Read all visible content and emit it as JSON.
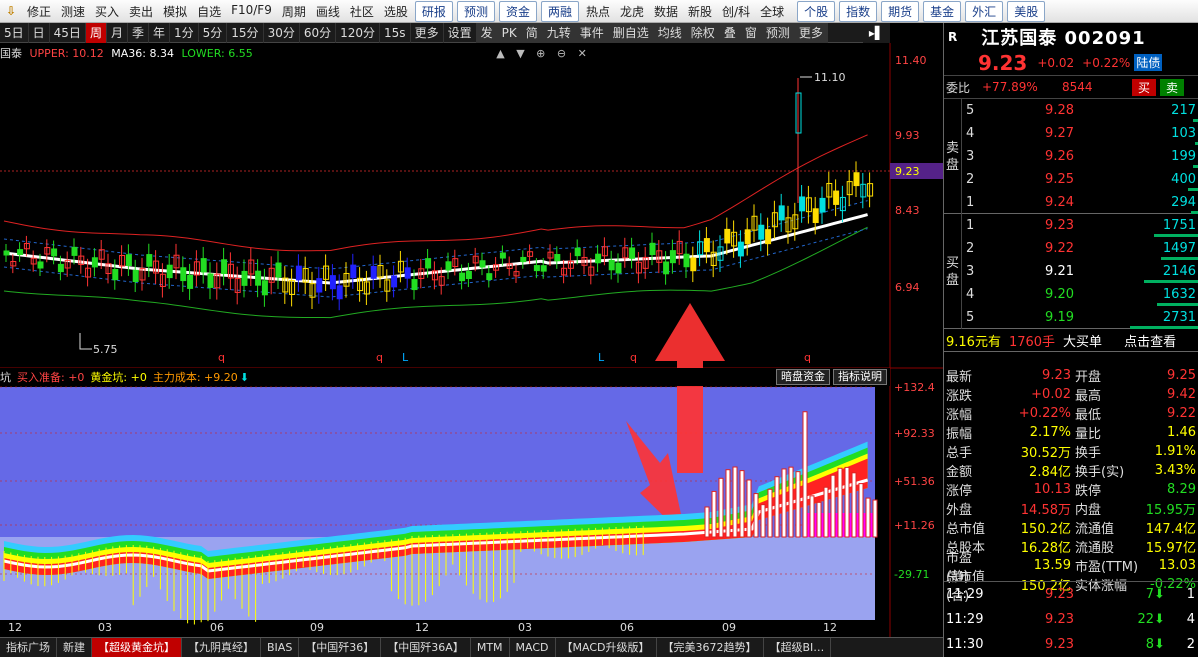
{
  "topbar": {
    "items": [
      "修正",
      "测速",
      "买入",
      "卖出",
      "模拟",
      "自选",
      "F10/F9",
      "周期",
      "画线",
      "社区",
      "选股"
    ],
    "boxed": [
      "研报",
      "预测",
      "资金",
      "两融"
    ],
    "items2": [
      "热点",
      "龙虎",
      "数据",
      "新股",
      "创/科",
      "全球"
    ],
    "boxed2": [
      "个股",
      "指数",
      "期货",
      "基金",
      "外汇",
      "美股"
    ]
  },
  "periodbar": {
    "items": [
      "5日",
      "日",
      "45日",
      "周",
      "月",
      "季",
      "年",
      "1分",
      "5分",
      "15分",
      "30分",
      "60分",
      "120分",
      "15s",
      "更多",
      "设置",
      "发",
      "PK",
      "简",
      "九转",
      "事件",
      "删自选",
      "均线",
      "除权",
      "叠",
      "窗",
      "预测",
      "更多"
    ],
    "active": "周"
  },
  "main_legend": {
    "name": "国泰",
    "upper": "UPPER: 10.12",
    "ma": "MA36: 8.34",
    "lower": "LOWER: 6.55"
  },
  "price_axis": [
    "11.40",
    "9.93",
    "9.23",
    "8.43",
    "6.94"
  ],
  "price_current": "9.23",
  "annot_high": "11.10",
  "annot_low": "5.75",
  "markers": [
    "q",
    "q",
    "L",
    "L",
    "q",
    "q"
  ],
  "indicator_legend": {
    "name": "坑",
    "buy": "买入准备: +0",
    "gold": "黄金坑: +0",
    "cost": "主力成本: +9.20",
    "btn1": "暗盘资金",
    "btn2": "指标说明"
  },
  "ind_axis": [
    "+132.4",
    "+92.33",
    "+51.36",
    "+11.26",
    "-29.71"
  ],
  "x_axis": [
    "12",
    "03",
    "06",
    "09",
    "12",
    "03",
    "06",
    "09",
    "12"
  ],
  "tabs": [
    "指标广场",
    "新建",
    "【超级黄金坑】",
    "【九阴真经】",
    "BIAS",
    "【中国歼36】",
    "【中国歼36A】",
    "MTM",
    "MACD",
    "【MACD升级版】",
    "【完美3672趋势】",
    "【超级BI…"
  ],
  "active_tab": "【超级黄金坑】",
  "quote": {
    "code_tag": "R",
    "title": "江苏国泰 002091",
    "price": "9.23",
    "change": "+0.02",
    "pct": "+0.22%",
    "badge": "陆债",
    "weibi_label": "委比",
    "weibi": "+77.89%",
    "weicha": "8544",
    "buy_btn": "买",
    "sell_btn": "卖"
  },
  "sell_side_label": "卖盘",
  "buy_side_label": "买盘",
  "asks": [
    {
      "lvl": "5",
      "price": "9.28",
      "vol": "217"
    },
    {
      "lvl": "4",
      "price": "9.27",
      "vol": "103"
    },
    {
      "lvl": "3",
      "price": "9.26",
      "vol": "199"
    },
    {
      "lvl": "2",
      "price": "9.25",
      "vol": "400"
    },
    {
      "lvl": "1",
      "price": "9.24",
      "vol": "294"
    }
  ],
  "bids": [
    {
      "lvl": "1",
      "price": "9.23",
      "vol": "1751"
    },
    {
      "lvl": "2",
      "price": "9.22",
      "vol": "1497"
    },
    {
      "lvl": "3",
      "price": "9.21",
      "vol": "2146"
    },
    {
      "lvl": "4",
      "price": "9.20",
      "vol": "1632"
    },
    {
      "lvl": "5",
      "price": "9.19",
      "vol": "2731"
    }
  ],
  "bigorder": {
    "price": "9.16元有",
    "vol": "1760手",
    "label": "大买单",
    "link": "点击查看"
  },
  "stats": [
    [
      "最新",
      "9.23",
      "开盘",
      "9.25"
    ],
    [
      "涨跌",
      "+0.02",
      "最高",
      "9.42"
    ],
    [
      "涨幅",
      "+0.22%",
      "最低",
      "9.22"
    ],
    [
      "振幅",
      "2.17%",
      "量比",
      "1.46"
    ],
    [
      "总手",
      "30.52万",
      "换手",
      "1.91%"
    ],
    [
      "金额",
      "2.84亿",
      "换手(实)",
      "3.43%"
    ],
    [
      "涨停",
      "10.13",
      "跌停",
      "8.29"
    ],
    [
      "外盘",
      "14.58万",
      "内盘",
      "15.95万"
    ],
    [
      "总市值",
      "150.2亿",
      "流通值",
      "147.4亿"
    ],
    [
      "总股本",
      "16.28亿",
      "流通股",
      "15.97亿"
    ],
    [
      "市盈(静)",
      "13.59",
      "市盈(TTM)",
      "13.03"
    ],
    [
      "总市值(合)",
      "150.2亿",
      "实体涨幅",
      "-0.22%"
    ]
  ],
  "ticks": [
    {
      "time": "11:29",
      "price": "9.23",
      "vol": "7",
      "n": "1"
    },
    {
      "time": "11:29",
      "price": "9.23",
      "vol": "22",
      "n": "4"
    },
    {
      "time": "11:30",
      "price": "9.23",
      "vol": "8",
      "n": "2"
    }
  ],
  "colors": {
    "up": "#ff3333",
    "down": "#22dd22",
    "accent": "#c00000"
  }
}
